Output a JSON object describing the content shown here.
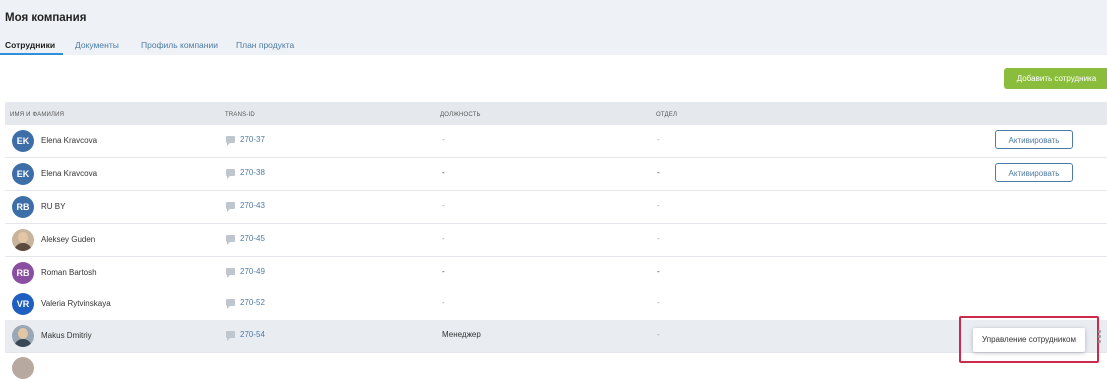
{
  "page": {
    "title": "Моя компания"
  },
  "tabs": [
    {
      "label": "Сотрудники",
      "active": true
    },
    {
      "label": "Документы",
      "active": false
    },
    {
      "label": "Профиль компании",
      "active": false
    },
    {
      "label": "План продукта",
      "active": false
    }
  ],
  "toolbar": {
    "add_label": "Добавить сотрудника"
  },
  "table": {
    "headers": [
      "Имя и фамилия",
      "TRANS-ID",
      "Должность",
      "Отдел"
    ],
    "rows": [
      {
        "initials": "EK",
        "avatar_color": "#3d6ea8",
        "name": "Elena Kravcova",
        "trans_id": "270-37",
        "position": "-",
        "dept": "-",
        "action": "Активировать"
      },
      {
        "initials": "EK",
        "avatar_color": "#3d6ea8",
        "name": "Elena Kravcova",
        "trans_id": "270-38",
        "position": "-",
        "dept": "-",
        "action": "Активировать"
      },
      {
        "initials": "RB",
        "avatar_color": "#3d6ea8",
        "name": "RU BY",
        "trans_id": "270-43",
        "position": "-",
        "dept": "-"
      },
      {
        "initials": "",
        "avatar_color": "",
        "name": "Aleksey Guden",
        "trans_id": "270-45",
        "position": "-",
        "dept": "-"
      },
      {
        "initials": "RB",
        "avatar_color": "#8a4fa0",
        "name": "Roman Bartosh",
        "trans_id": "270-49",
        "position": "-",
        "dept": "-"
      },
      {
        "initials": "VR",
        "avatar_color": "#1f5fbf",
        "name": "Valeria Rytvinskaya",
        "trans_id": "270-52",
        "position": "-",
        "dept": "-"
      },
      {
        "initials": "",
        "avatar_color": "",
        "name": "Makus Dmitriy",
        "trans_id": "270-54",
        "position": "Менеджер",
        "dept": "-"
      }
    ]
  },
  "context_menu": {
    "manage_label": "Управление сотрудником"
  }
}
